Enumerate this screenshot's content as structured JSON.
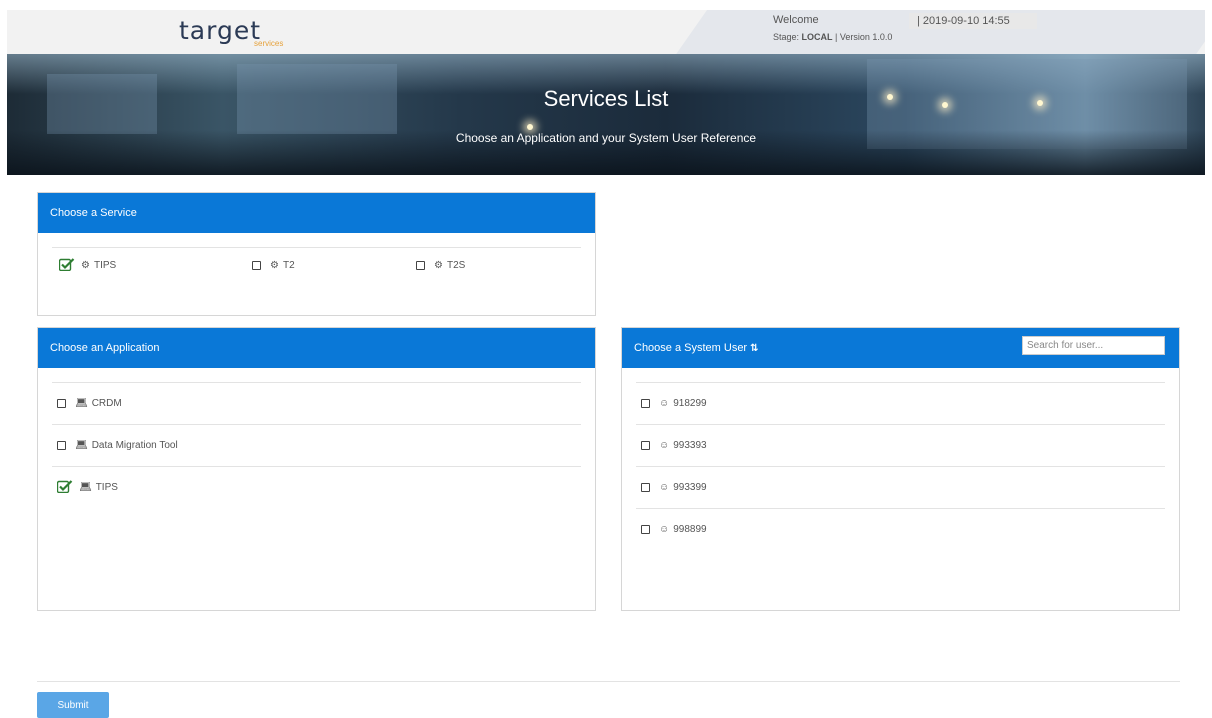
{
  "header": {
    "logo_main": "target",
    "logo_sub": "services",
    "welcome": "Welcome",
    "datetime": "| 2019-09-10 14:55",
    "stage_prefix": "Stage: ",
    "stage_value": "LOCAL",
    "version_prefix": " | Version ",
    "version_value": "1.0.0"
  },
  "banner": {
    "title": "Services List",
    "subtitle": "Choose an Application and your System User Reference"
  },
  "services_panel": {
    "title": "Choose a Service",
    "items": [
      {
        "label": "TIPS",
        "checked": true,
        "icon": "gear-icon"
      },
      {
        "label": "T2",
        "checked": false,
        "icon": "gear-icon"
      },
      {
        "label": "T2S",
        "checked": false,
        "icon": "gear-icon"
      }
    ]
  },
  "applications_panel": {
    "title": "Choose an Application",
    "items": [
      {
        "label": "CRDM",
        "checked": false,
        "icon": "laptop-icon"
      },
      {
        "label": "Data Migration Tool",
        "checked": false,
        "icon": "laptop-icon"
      },
      {
        "label": "TIPS",
        "checked": true,
        "icon": "laptop-icon"
      }
    ]
  },
  "users_panel": {
    "title": "Choose a System User",
    "search_placeholder": "Search for user...",
    "items": [
      {
        "label": "918299",
        "checked": false,
        "icon": "user-icon"
      },
      {
        "label": "993393",
        "checked": false,
        "icon": "user-icon"
      },
      {
        "label": "993399",
        "checked": false,
        "icon": "user-icon"
      },
      {
        "label": "998899",
        "checked": false,
        "icon": "user-icon"
      }
    ]
  },
  "footer": {
    "submit_label": "Submit"
  },
  "colors": {
    "accent": "#0a78d7",
    "check_green": "#2e7d32",
    "submit": "#5aa6e6"
  }
}
